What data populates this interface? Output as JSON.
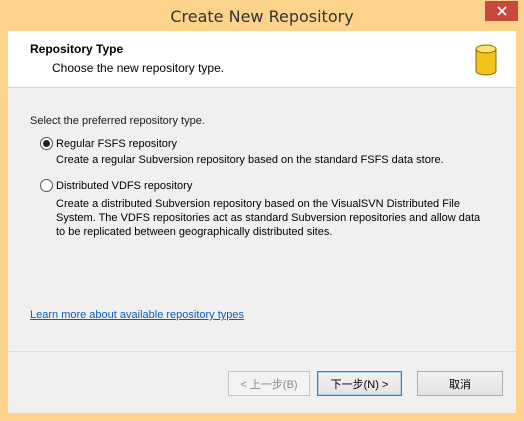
{
  "window": {
    "title": "Create New Repository"
  },
  "header": {
    "title": "Repository Type",
    "subtitle": "Choose the new repository type.",
    "icon": "database-icon"
  },
  "main": {
    "prompt": "Select the preferred repository type.",
    "options": [
      {
        "label": "Regular FSFS repository",
        "selected": true,
        "description": "Create a regular Subversion repository based on the standard FSFS data store."
      },
      {
        "label": "Distributed VDFS repository",
        "selected": false,
        "description_lines": [
          "Create a distributed Subversion repository based on the VisualSVN Distributed File",
          "System. The VDFS repositories act as standard Subversion repositories and allow data",
          "to be replicated between geographically distributed sites."
        ]
      }
    ],
    "learn_more": "Learn more about available repository types"
  },
  "footer": {
    "back_label": "< 上一步(B)",
    "next_label": "下一步(N) >",
    "cancel_label": "取消"
  },
  "colors": {
    "titlebar": "#fdd38b",
    "close": "#c9483c",
    "link": "#0a5cc1",
    "icon": "#f2c21b"
  }
}
